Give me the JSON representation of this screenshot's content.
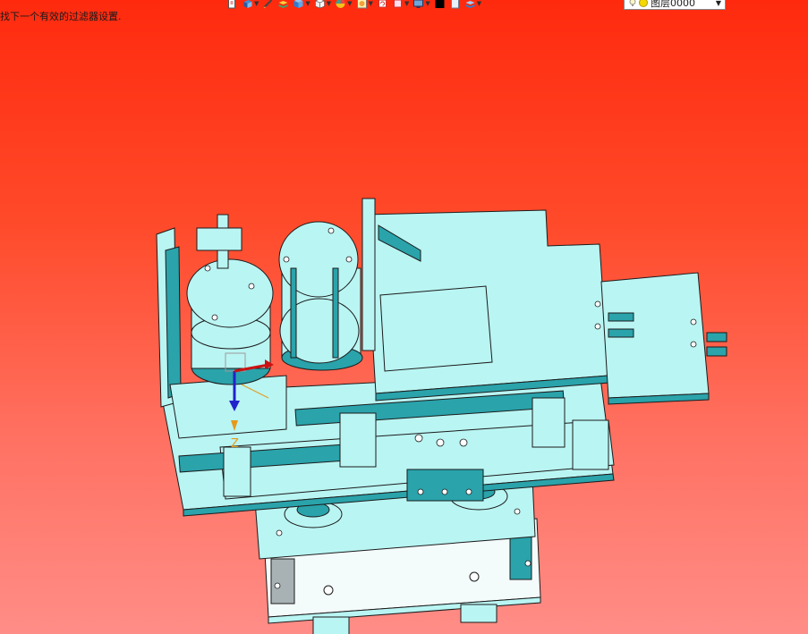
{
  "status_message": "找下一个有效的过滤器设置.",
  "toolbar": {
    "buttons": [
      {
        "icon": "new-sketch-icon",
        "dropdown": false
      },
      {
        "icon": "view-orient-icon",
        "dropdown": true
      },
      {
        "icon": "pencil-icon",
        "dropdown": false
      },
      {
        "icon": "layer-stack-icon",
        "dropdown": false
      },
      {
        "icon": "shaded-cube-icon",
        "dropdown": true
      },
      {
        "icon": "wire-cube-icon",
        "dropdown": true
      },
      {
        "icon": "color-wheel-icon",
        "dropdown": true
      },
      {
        "icon": "render-icon",
        "dropdown": true
      },
      {
        "icon": "refresh-icon",
        "dropdown": false
      },
      {
        "icon": "frame-icon",
        "dropdown": true
      },
      {
        "icon": "monitor-icon",
        "dropdown": true
      },
      {
        "icon": "black-color-swatch-icon",
        "dropdown": false
      },
      {
        "icon": "white-sheet-icon",
        "dropdown": false
      },
      {
        "icon": "blue-layers-icon",
        "dropdown": true
      }
    ],
    "layer_select": {
      "value": "图层0000"
    }
  },
  "colors": {
    "model_fill": "#b9f5f3",
    "model_dark": "#2aa3ab",
    "edge": "#1b1b1b",
    "axis_z": "#2222cc",
    "axis_x": "#cc1111",
    "triad_label": "#e59a1a"
  },
  "triad": {
    "label_z": "Z"
  }
}
